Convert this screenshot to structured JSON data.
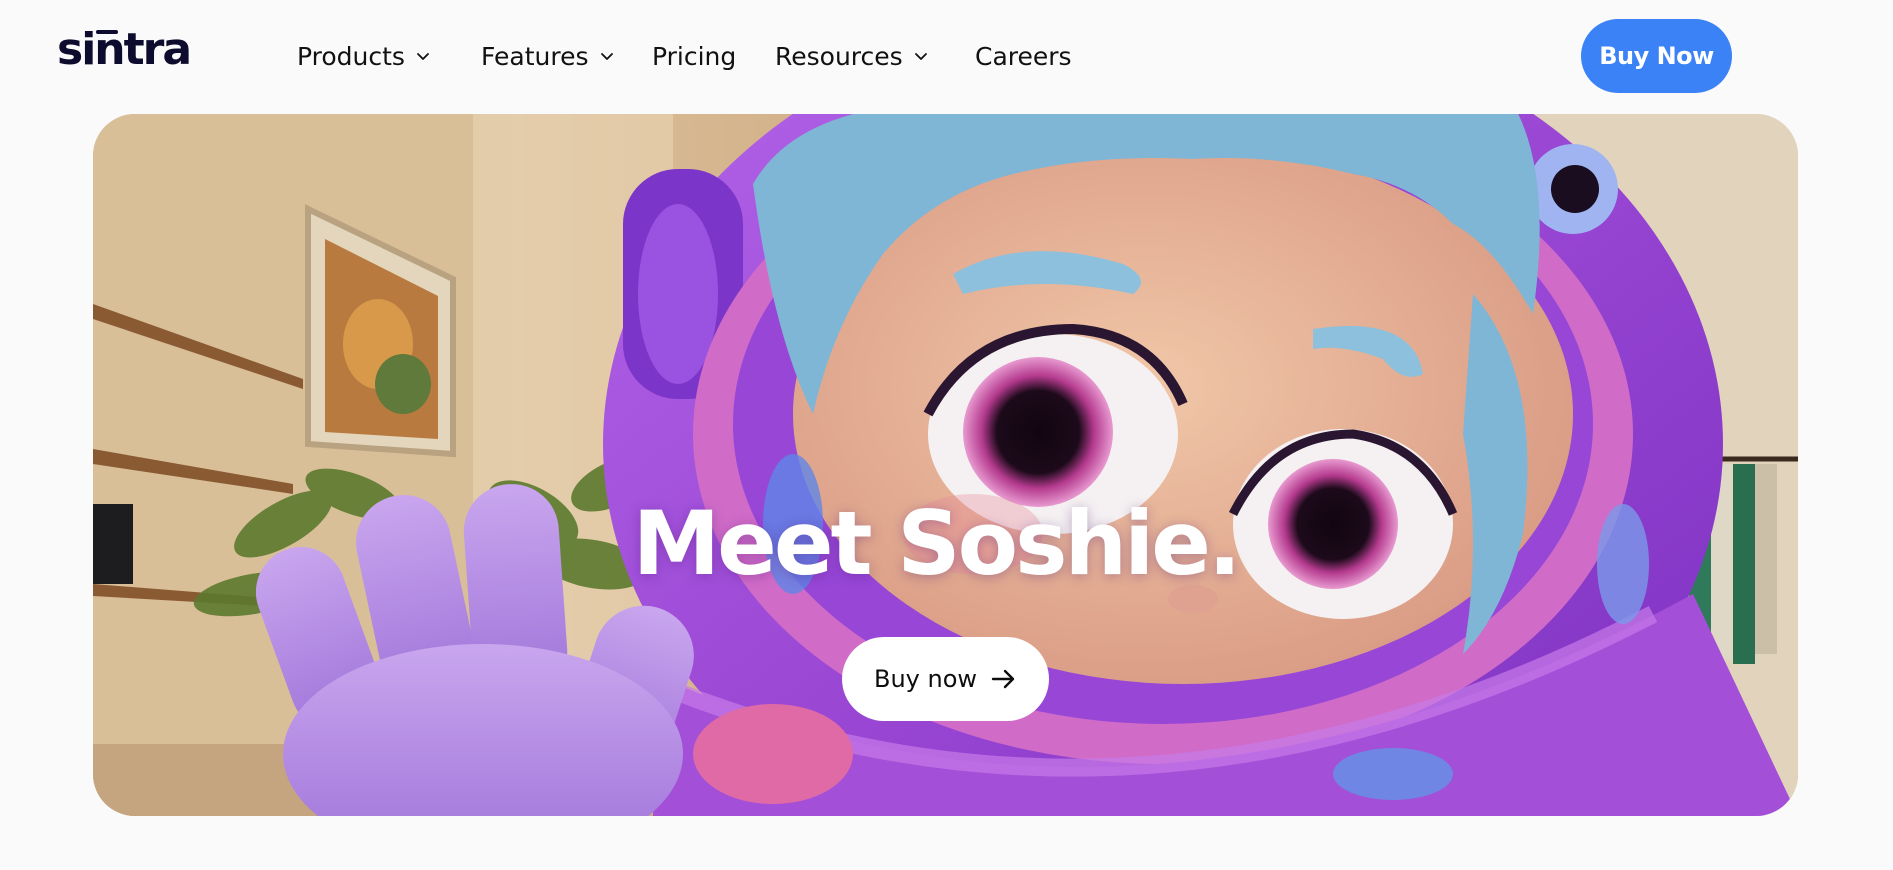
{
  "brand": {
    "logo_text": "sintra"
  },
  "nav": {
    "items": [
      {
        "label": "Products",
        "has_dropdown": true
      },
      {
        "label": "Features",
        "has_dropdown": true
      },
      {
        "label": "Pricing",
        "has_dropdown": false
      },
      {
        "label": "Resources",
        "has_dropdown": true
      },
      {
        "label": "Careers",
        "has_dropdown": false
      }
    ],
    "cta_label": "Buy Now"
  },
  "hero": {
    "title": "Meet Soshie.",
    "cta_label": "Buy now",
    "cta_icon": "arrow-right-icon",
    "image_subject": "3d-character-soshie-in-purple-space-helmet"
  },
  "colors": {
    "accent": "#3b82f6",
    "text": "#0e0c2e",
    "background": "#fafafa",
    "helmet": "#a04fd6",
    "hair": "#7fb6d6"
  }
}
